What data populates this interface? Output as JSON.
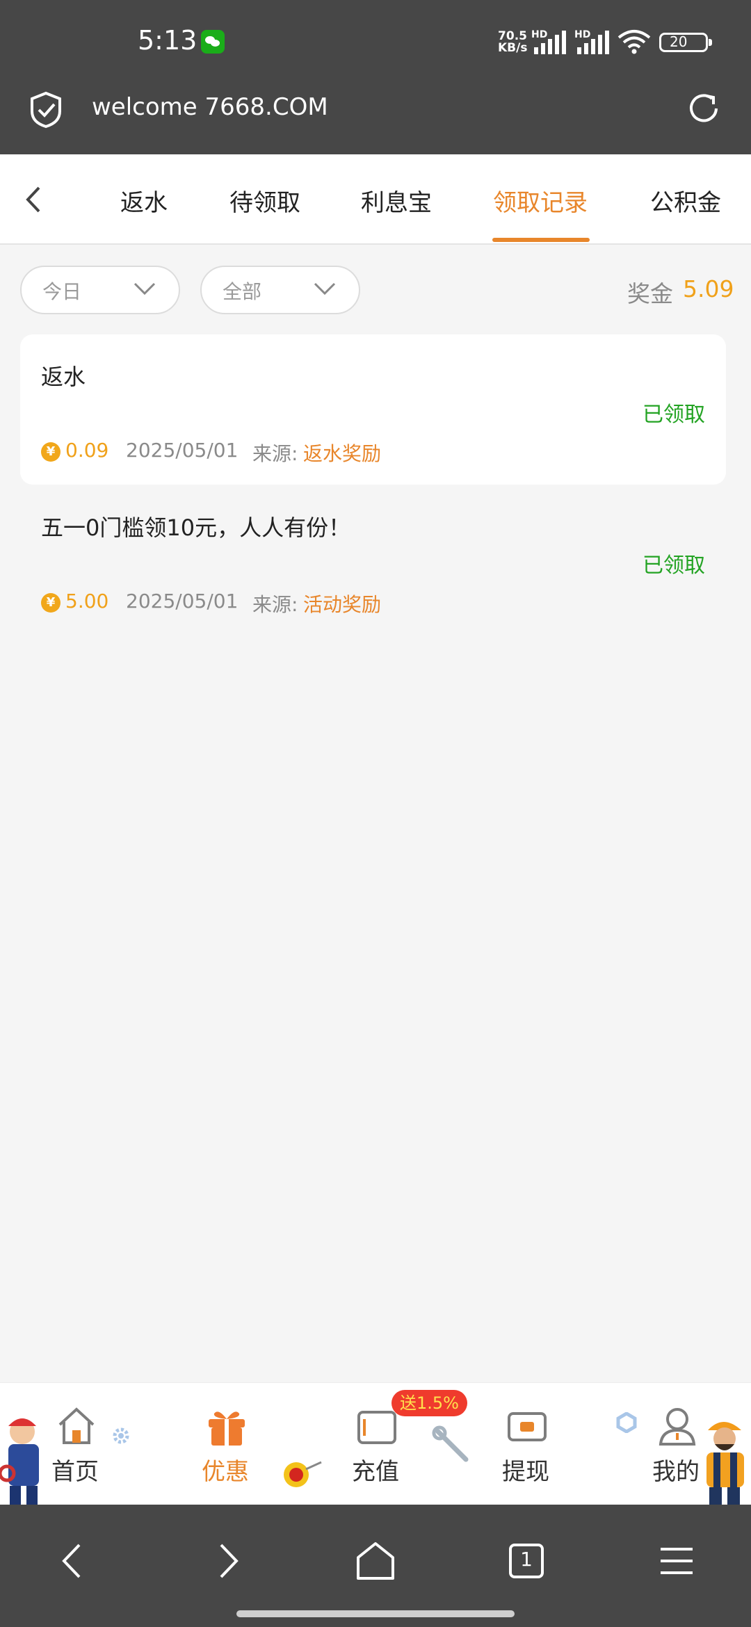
{
  "status_bar": {
    "time": "5:13",
    "net_speed_value": "70.5",
    "net_speed_unit": "KB/s",
    "hd1": "HD",
    "hd2": "HD",
    "battery": "20"
  },
  "browser": {
    "address": "welcome 7668.COM"
  },
  "tabs": [
    {
      "label": "返水"
    },
    {
      "label": "待领取"
    },
    {
      "label": "利息宝"
    },
    {
      "label": "领取记录",
      "active": true
    },
    {
      "label": "公积金"
    }
  ],
  "filters": {
    "date": "今日",
    "type": "全部"
  },
  "bonus": {
    "label": "奖金",
    "value": "5.09"
  },
  "records": [
    {
      "title": "返水",
      "status": "已领取",
      "coin": "¥",
      "amount": "0.09",
      "date": "2025/05/01",
      "source_label": "来源:",
      "source": "返水奖励"
    },
    {
      "title": "五一0门槛领10元，人人有份！",
      "status": "已领取",
      "coin": "¥",
      "amount": "5.00",
      "date": "2025/05/01",
      "source_label": "来源:",
      "source": "活动奖励"
    }
  ],
  "bottom_nav": [
    {
      "label": "首页",
      "icon": "home-icon"
    },
    {
      "label": "优惠",
      "icon": "gift-icon",
      "active": true
    },
    {
      "label": "充值",
      "icon": "wallet-icon",
      "badge": "送1.5%"
    },
    {
      "label": "提现",
      "icon": "cash-icon"
    },
    {
      "label": "我的",
      "icon": "user-icon"
    }
  ],
  "colors": {
    "accent": "#e8862b",
    "success": "#23a323",
    "coin": "#f1a71b",
    "header_bg": "#474747"
  },
  "system_nav": {
    "tab_count": "1"
  }
}
